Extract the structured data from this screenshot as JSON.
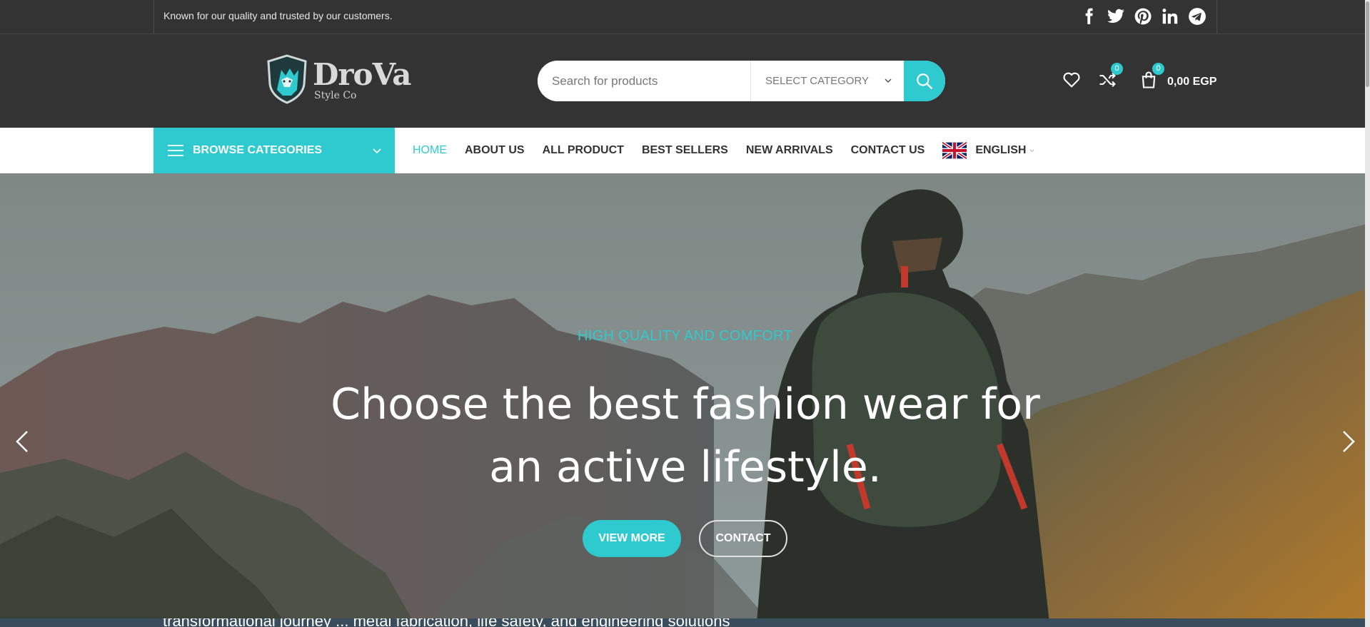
{
  "topbar": {
    "text": "Known for our quality and trusted by our customers.",
    "social": [
      "facebook-icon",
      "twitter-icon",
      "pinterest-icon",
      "linkedin-icon",
      "telegram-icon"
    ]
  },
  "header": {
    "logo_text": "DroVa",
    "logo_sub": "Style Co",
    "search_placeholder": "Search for products",
    "category_label": "SELECT CATEGORY",
    "compare_count": "0",
    "cart_count": "0",
    "cart_amount": "0,00 EGP"
  },
  "nav": {
    "browse_label": "BROWSE CATEGORIES",
    "items": [
      "HOME",
      "ABOUT US",
      "ALL PRODUCT",
      "BEST SELLERS",
      "NEW ARRIVALS",
      "CONTACT US"
    ],
    "language": "ENGLISH"
  },
  "hero": {
    "kicker": "HIGH QUALITY AND COMFORT",
    "title": "Choose the best fashion wear for an active lifestyle.",
    "view_more": "VIEW MORE",
    "contact": "CONTACT"
  },
  "bottom_cut_text": "transformational journey ... metal fabrication, life safety, and engineering solutions",
  "colors": {
    "accent": "#2ecacf",
    "dark": "#333333"
  }
}
